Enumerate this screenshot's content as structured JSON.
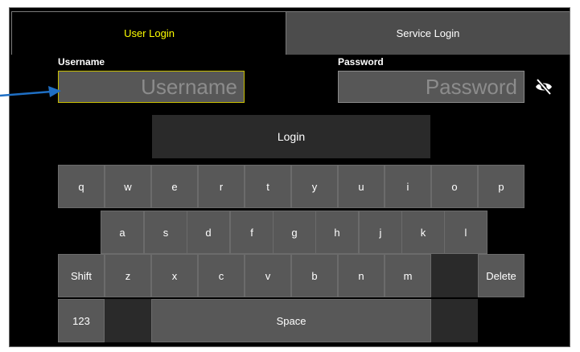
{
  "tabs": {
    "user": "User Login",
    "service": "Service Login"
  },
  "fields": {
    "username_label": "Username",
    "username_placeholder": "Username",
    "password_label": "Password",
    "password_placeholder": "Password"
  },
  "login_label": "Login",
  "keyboard": {
    "row1": [
      "q",
      "w",
      "e",
      "r",
      "t",
      "y",
      "u",
      "i",
      "o",
      "p"
    ],
    "row2": [
      "a",
      "s",
      "d",
      "f",
      "g",
      "h",
      "j",
      "k",
      "l"
    ],
    "row3": [
      "Shift",
      "z",
      "x",
      "c",
      "v",
      "b",
      "n",
      "m",
      "",
      "Delete"
    ],
    "row4": [
      "123",
      "",
      "Space",
      ""
    ]
  },
  "colors": {
    "active_tab_text": "#ffff00",
    "field_border_focus": "#c8bf00",
    "arrow": "#1f6fc4"
  },
  "icons": {
    "password_toggle": "eye-slash-icon",
    "pointer": "arrow-pointer-icon"
  }
}
